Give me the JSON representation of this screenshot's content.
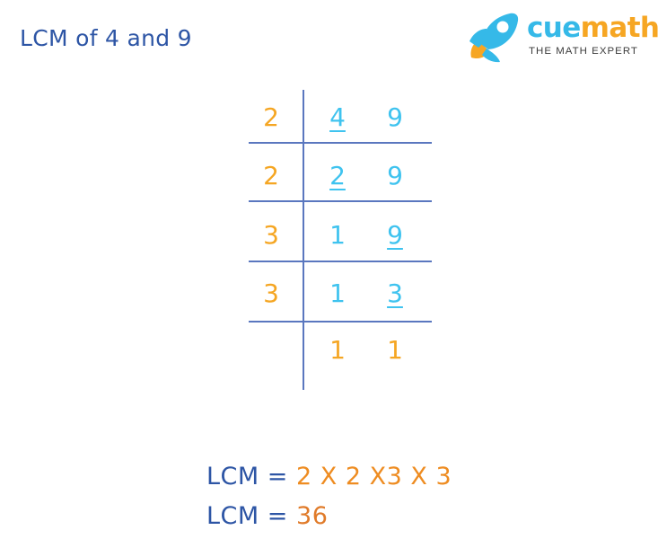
{
  "page": {
    "title": "LCM of 4 and 9",
    "background": "#ffffff"
  },
  "logo": {
    "icon": "rocket-icon",
    "word_1": "cue",
    "word_2": "math",
    "tagline": "THE MATH EXPERT",
    "color_cue": "#35b9e8",
    "color_math": "#f6a623",
    "color_tagline": "#3b3b3b"
  },
  "colors": {
    "title_blue": "#2d55a5",
    "divisor_orange": "#f5a623",
    "quotient_cyan": "#3fc3ef",
    "rule_blue": "#5a77bf",
    "result_orange": "#ee8c21"
  },
  "ladder": {
    "type": "division-ladder",
    "numbers": [
      4,
      9
    ],
    "rows": [
      {
        "divisor": "2",
        "quotients": [
          "4",
          "9"
        ],
        "quotient_colors": [
          "cyan",
          "cyan"
        ],
        "underlined": [
          true,
          false
        ]
      },
      {
        "divisor": "2",
        "quotients": [
          "2",
          "9"
        ],
        "quotient_colors": [
          "cyan",
          "cyan"
        ],
        "underlined": [
          true,
          false
        ]
      },
      {
        "divisor": "3",
        "quotients": [
          "1",
          "9"
        ],
        "quotient_colors": [
          "cyan",
          "cyan"
        ],
        "underlined": [
          false,
          true
        ]
      },
      {
        "divisor": "3",
        "quotients": [
          "1",
          "3"
        ],
        "quotient_colors": [
          "cyan",
          "cyan"
        ],
        "underlined": [
          false,
          true
        ]
      },
      {
        "divisor": "",
        "quotients": [
          "1",
          "1"
        ],
        "quotient_colors": [
          "orange",
          "orange"
        ],
        "underlined": [
          false,
          false
        ]
      }
    ]
  },
  "result": {
    "line_1_label": "LCM",
    "line_1_eq": "=",
    "line_1_value": "2 X 2 X3 X 3",
    "line_2_label": "LCM",
    "line_2_eq": "=",
    "line_2_value": "36"
  }
}
